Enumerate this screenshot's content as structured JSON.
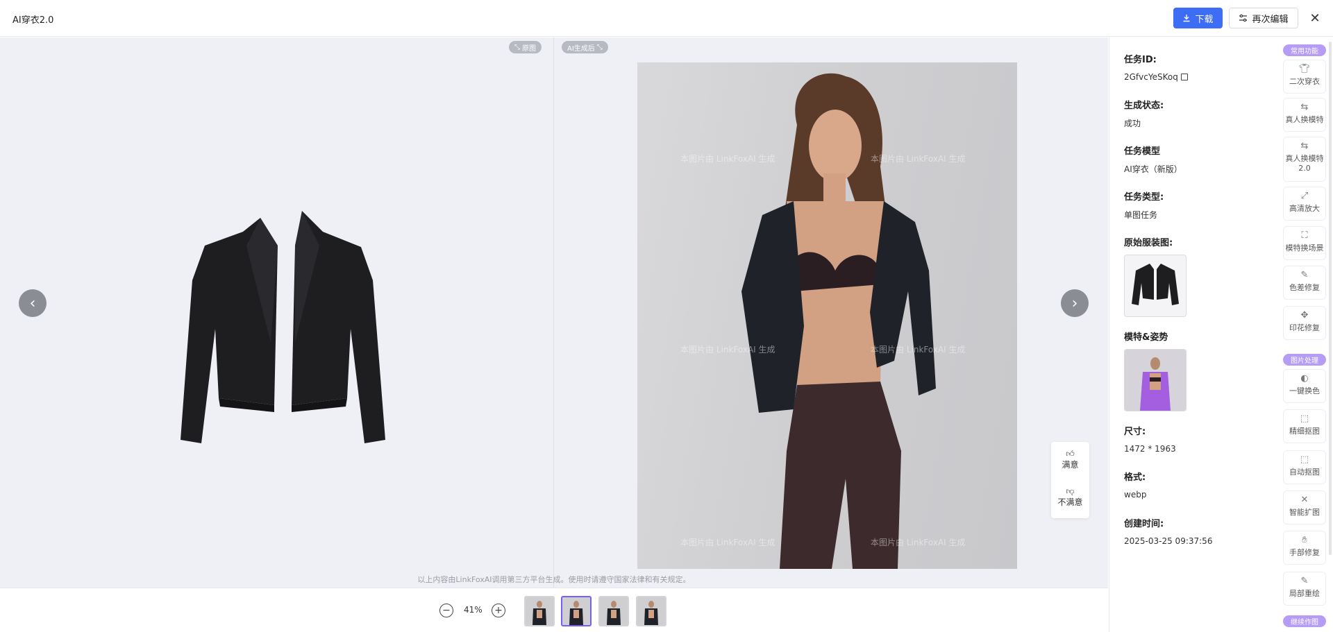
{
  "header": {
    "app_title": "AI穿衣2.0",
    "download_label": "下载",
    "reedit_label": "再次编辑",
    "close_glyph": "✕"
  },
  "viewer": {
    "before_pill": "原图",
    "after_pill": "AI生成后",
    "prev_glyph": "‹",
    "next_glyph": "›",
    "watermark_text": "本图片由 LinkFoxAI 生成",
    "feedback": {
      "good": "满意",
      "bad": "不满意"
    },
    "disclaimer": "以上内容由LinkFoxAI调用第三方平台生成。使用时请遵守国家法律和有关规定。"
  },
  "footer": {
    "zoom_out_glyph": "−",
    "zoom_in_glyph": "+",
    "zoom": "41%",
    "thumbnails": [
      {
        "active": false
      },
      {
        "active": true
      },
      {
        "active": false
      },
      {
        "active": false
      }
    ]
  },
  "info": {
    "task_id_label": "任务ID:",
    "task_id": "2GfvcYeSKoq",
    "status_label": "生成状态:",
    "status": "成功",
    "model_label": "任务模型",
    "model": "AI穿衣（新版）",
    "type_label": "任务类型:",
    "type": "单图任务",
    "garment_label": "原始服装图:",
    "pose_label": "模特&姿势",
    "size_label": "尺寸:",
    "size": "1472 * 1963",
    "format_label": "格式:",
    "format": "webp",
    "created_label": "创建时间:",
    "created": "2025-03-25 09:37:56"
  },
  "toolbar": {
    "categories": {
      "common": "常用功能",
      "image": "图片处理",
      "continue": "继续作图"
    },
    "tools": {
      "t1": "二次穿衣",
      "t2": "真人换模特",
      "t3": "真人换模特2.0",
      "t4": "高清放大",
      "t5": "模特换场景",
      "t6": "色差修复",
      "t7": "印花修复",
      "t8": "一键换色",
      "t9": "精细抠图",
      "t10": "自动抠图",
      "t11": "智能扩图",
      "t12": "手部修复",
      "t13": "局部重绘"
    }
  },
  "colors": {
    "primary": "#3d6cf5",
    "accent_purple": "#b69cf5",
    "stage_bg": "#eef0f5"
  }
}
